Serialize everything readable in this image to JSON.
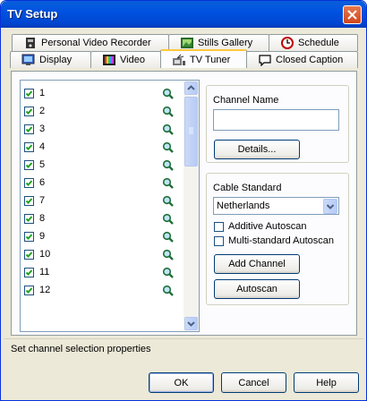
{
  "window": {
    "title": "TV Setup"
  },
  "tabs_row1": [
    {
      "label": "Personal Video Recorder",
      "icon": "pvr-icon"
    },
    {
      "label": "Stills Gallery",
      "icon": "stills-gallery-icon"
    },
    {
      "label": "Schedule",
      "icon": "schedule-icon"
    }
  ],
  "tabs_row2": [
    {
      "label": "Display",
      "icon": "display-icon"
    },
    {
      "label": "Video",
      "icon": "video-icon"
    },
    {
      "label": "TV Tuner",
      "icon": "tv-tuner-icon",
      "active": true
    },
    {
      "label": "Closed Caption",
      "icon": "closed-caption-icon"
    }
  ],
  "channels": [
    {
      "number": "1",
      "checked": true
    },
    {
      "number": "2",
      "checked": true
    },
    {
      "number": "3",
      "checked": true
    },
    {
      "number": "4",
      "checked": true
    },
    {
      "number": "5",
      "checked": true
    },
    {
      "number": "6",
      "checked": true
    },
    {
      "number": "7",
      "checked": true
    },
    {
      "number": "8",
      "checked": true
    },
    {
      "number": "9",
      "checked": true
    },
    {
      "number": "10",
      "checked": true
    },
    {
      "number": "11",
      "checked": true
    },
    {
      "number": "12",
      "checked": true
    }
  ],
  "channel_name": {
    "label": "Channel Name",
    "value": "",
    "details_button": "Details..."
  },
  "cable_standard": {
    "label": "Cable Standard",
    "selected": "Netherlands",
    "additive_autoscan": {
      "label": "Additive Autoscan",
      "checked": false
    },
    "multistandard_autoscan": {
      "label": "Multi-standard Autoscan",
      "checked": false
    },
    "add_channel_button": "Add Channel",
    "autoscan_button": "Autoscan"
  },
  "status": "Set channel selection properties",
  "buttons": {
    "ok": "OK",
    "cancel": "Cancel",
    "help": "Help"
  },
  "colors": {
    "titlebar": "#0054e3",
    "face": "#ece9d8",
    "active_tab_accent": "#ffc83c"
  }
}
